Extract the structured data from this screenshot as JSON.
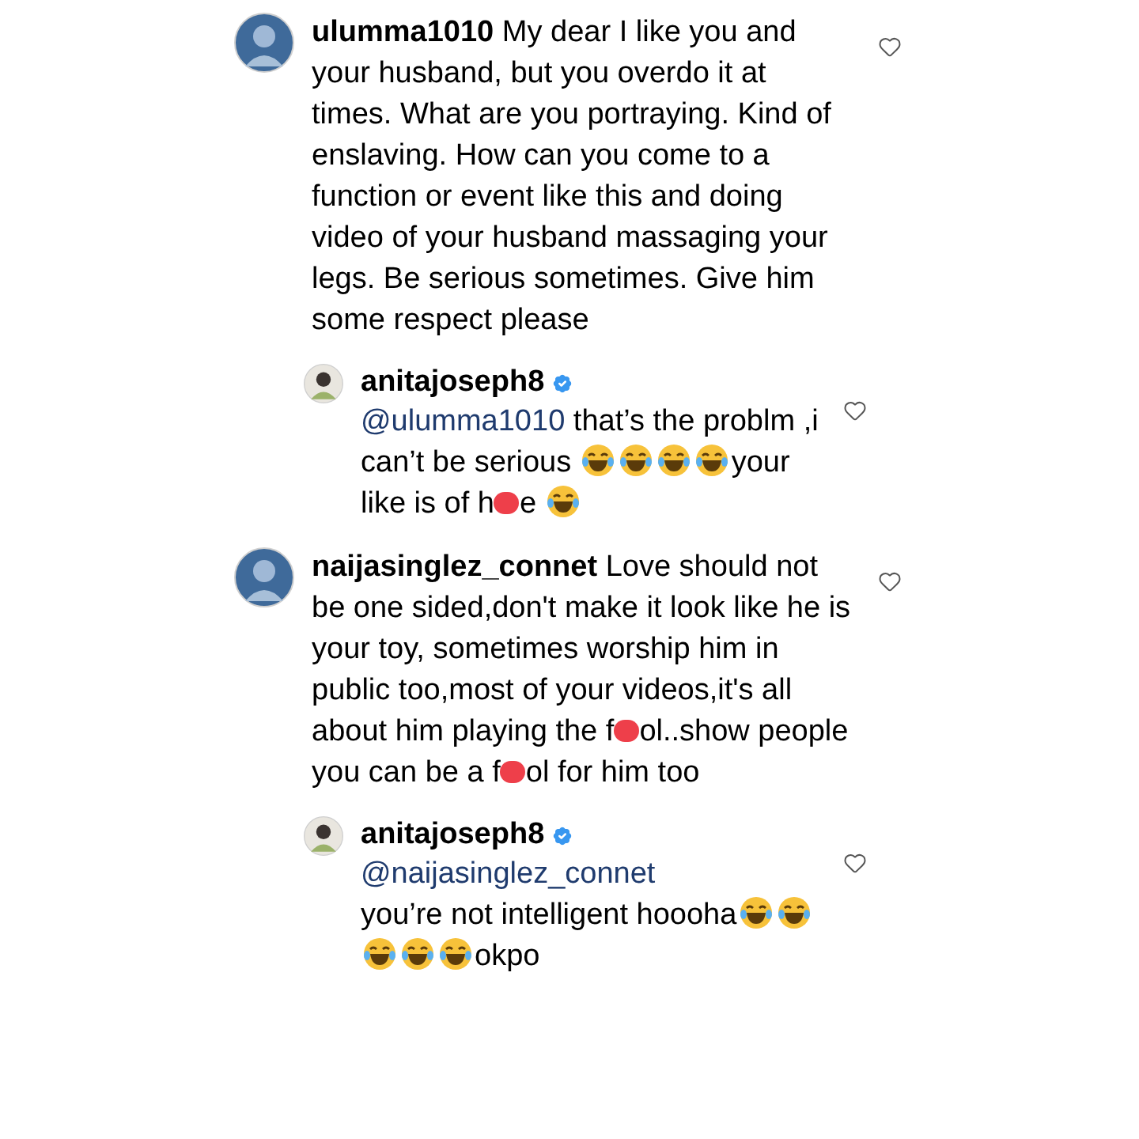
{
  "comments": [
    {
      "kind": "comment",
      "username": "ulumma1010",
      "verified": false,
      "body": [
        {
          "kind": "text",
          "text": "My dear I like you and your husband, but you overdo it at times. What are you portraying. Kind of enslaving. How can you come to a function or event like this and doing video of your husband massaging your legs. Be serious sometimes. Give him some respect please"
        }
      ]
    },
    {
      "kind": "reply",
      "username": "anitajoseph8",
      "verified": true,
      "body": [
        {
          "kind": "mention",
          "text": "@ulumma1010"
        },
        {
          "kind": "text",
          "text": " that’s the problm ,i can’t be serious "
        },
        {
          "kind": "emoji"
        },
        {
          "kind": "emoji"
        },
        {
          "kind": "emoji"
        },
        {
          "kind": "emoji"
        },
        {
          "kind": "text",
          "text": "your like is of h"
        },
        {
          "kind": "censor"
        },
        {
          "kind": "text",
          "text": "e "
        },
        {
          "kind": "emoji"
        }
      ]
    },
    {
      "kind": "comment",
      "username": "naijasinglez_connet",
      "verified": false,
      "body": [
        {
          "kind": "text",
          "text": "Love should not be one sided,don't make it look like he is your toy, sometimes worship him in public too,most of your videos,it's all about him playing the f"
        },
        {
          "kind": "censor"
        },
        {
          "kind": "text",
          "text": "ol..show people you can be a f"
        },
        {
          "kind": "censor"
        },
        {
          "kind": "text",
          "text": "ol for him too"
        }
      ]
    },
    {
      "kind": "reply",
      "username": "anitajoseph8",
      "verified": true,
      "body": [
        {
          "kind": "mention",
          "text": "@naijasinglez_connet"
        },
        {
          "kind": "break"
        },
        {
          "kind": "text",
          "text": "you’re not intelligent hoooha"
        },
        {
          "kind": "emoji"
        },
        {
          "kind": "emoji"
        },
        {
          "kind": "emoji"
        },
        {
          "kind": "emoji"
        },
        {
          "kind": "emoji"
        },
        {
          "kind": "text",
          "text": "okpo"
        }
      ]
    }
  ]
}
